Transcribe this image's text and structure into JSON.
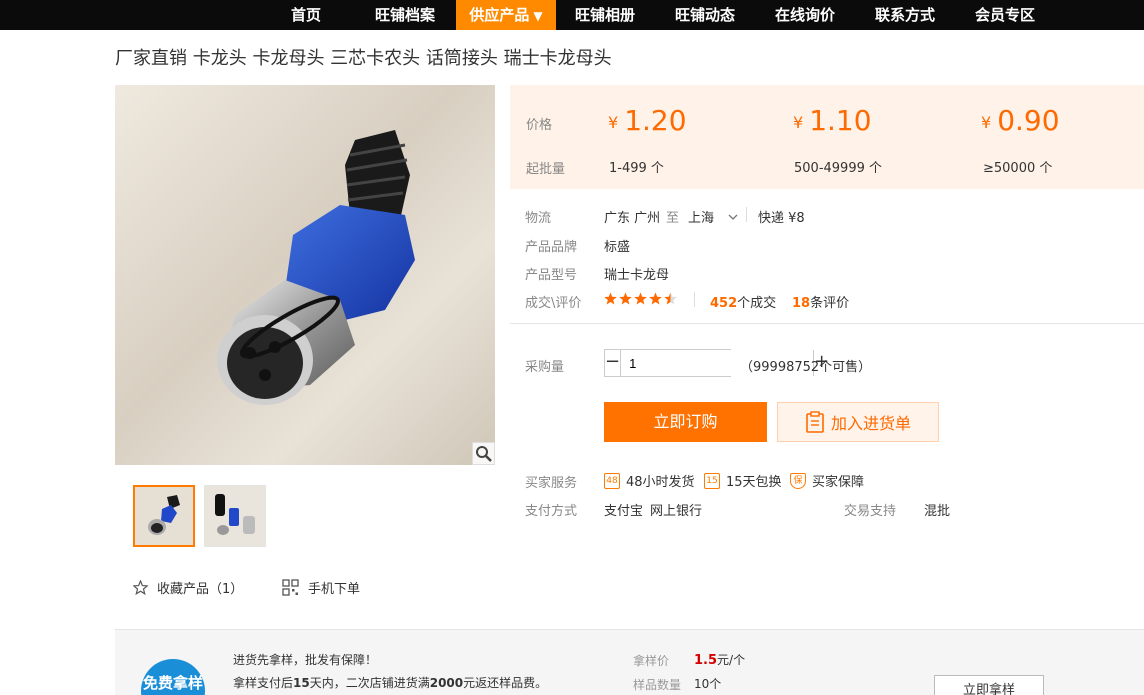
{
  "nav": {
    "items": [
      "首页",
      "旺铺档案",
      "供应产品",
      "旺铺相册",
      "旺铺动态",
      "在线询价",
      "联系方式",
      "会员专区"
    ],
    "active_caret": "▼"
  },
  "product": {
    "title": "厂家直销 卡龙头 卡龙母头 三芯卡农头 话筒接头 瑞士卡龙母头"
  },
  "pricing": {
    "price_label": "价格",
    "moq_label": "起批量",
    "currency": "¥",
    "tiers": [
      {
        "price": "1.20",
        "qty": "1-499 个"
      },
      {
        "price": "1.10",
        "qty": "500-49999 个"
      },
      {
        "price": "0.90",
        "qty": "≥50000 个"
      }
    ]
  },
  "details": {
    "logistics_label": "物流",
    "from": "广东 广州",
    "to_word": "至",
    "dest": "上海",
    "shipping": "快递 ¥8",
    "brand_label": "产品品牌",
    "brand": "标盛",
    "model_label": "产品型号",
    "model": "瑞士卡龙母",
    "deals_label": "成交\\评价",
    "rating": 4.5,
    "deals_count": "452",
    "deals_suffix": "个成交",
    "reviews_count": "18",
    "reviews_suffix": "条评价"
  },
  "purchase": {
    "qty_label": "采购量",
    "qty_value": "1",
    "stock_note": "（99998752个可售）",
    "buy_label": "立即订购",
    "cart_label": "加入进货单"
  },
  "services": {
    "label": "买家服务",
    "items": [
      {
        "icon": "48",
        "text": "48小时发货"
      },
      {
        "icon": "15",
        "text": "15天包换"
      },
      {
        "icon": "保",
        "text": "买家保障"
      }
    ],
    "payment_label": "支付方式",
    "payments": [
      "支付宝",
      "网上银行"
    ],
    "trade_label": "交易支持",
    "trade_value": "混批"
  },
  "gallery": {
    "favorite_label": "收藏产品（1）",
    "mobile_label": "手机下单"
  },
  "sample": {
    "badge": "免费拿样",
    "line1": "进货先拿样，批发有保障！",
    "line2_a": "拿样支付后",
    "line2_b": "15",
    "line2_c": "天内，二次店铺进货满",
    "line2_d": "2000",
    "line2_e": "元返还样品费。",
    "price_label": "拿样价",
    "price_value": "1.5",
    "price_unit": "元/个",
    "qty_label": "样品数量",
    "qty_value": "10个",
    "button": "立即拿样"
  }
}
